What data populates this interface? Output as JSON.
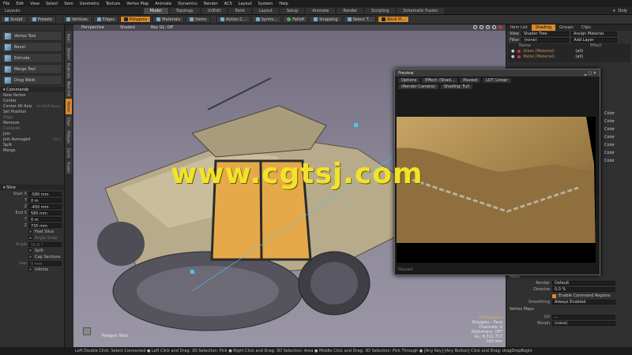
{
  "menu": [
    "File",
    "Edit",
    "View",
    "Select",
    "Item",
    "Geometry",
    "Texture",
    "Vertex Map",
    "Animate",
    "Dynamics",
    "Render",
    "ACS",
    "Layout",
    "System",
    "Help"
  ],
  "layout_label": "Layouts",
  "mode_tabs": [
    {
      "label": "Model",
      "active": true
    },
    {
      "label": "Topology",
      "active": false
    },
    {
      "label": "UVEdit",
      "active": false
    },
    {
      "label": "Paint",
      "active": false
    },
    {
      "label": "Layout",
      "active": false
    },
    {
      "label": "Setup",
      "active": false
    },
    {
      "label": "Animate",
      "active": false
    },
    {
      "label": "Render",
      "active": false
    },
    {
      "label": "Scripting",
      "active": false
    },
    {
      "label": "Schematic Fusion",
      "active": false
    }
  ],
  "only_label": "Only",
  "toolbar": {
    "sculpt": "Sculpt",
    "presets": "Presets",
    "vertices": "Vertices",
    "edges": "Edges",
    "polygons": "Polygons",
    "materials": "Materials",
    "items": "Items",
    "action_center": "Action C...",
    "symmetry": "Symm...",
    "falloff": "Falloff",
    "snapping": "Snapping",
    "select_through": "Select T...",
    "work_plane": "Work Pl..."
  },
  "tools": [
    "Vertex Tool",
    "Bevel",
    "Extrude",
    "Merge Tool",
    "Drag Weld"
  ],
  "commands": {
    "header": "Commands",
    "items": [
      {
        "label": "New Vertex",
        "key": "",
        "dim": false
      },
      {
        "label": "Center",
        "key": "",
        "dim": false
      },
      {
        "label": "Center All Axis",
        "key": "Ctrl-Shift-Space",
        "dim": false
      },
      {
        "label": "Set Position",
        "key": "",
        "dim": false
      },
      {
        "label": "Align",
        "key": "",
        "dim": true
      },
      {
        "label": "Remove",
        "key": "",
        "dim": false
      },
      {
        "label": "Collapse",
        "key": "",
        "dim": true
      },
      {
        "label": "Join",
        "key": "",
        "dim": false
      },
      {
        "label": "Join Averaged",
        "key": "Ctrl-J",
        "dim": false
      },
      {
        "label": "Split",
        "key": "",
        "dim": false
      },
      {
        "label": "Merge",
        "key": "",
        "dim": false
      }
    ]
  },
  "side_tabs": [
    "Basic",
    "Deform",
    "Duplicate",
    "Mesh Edit",
    "Vertex",
    "Edge",
    "Polygon",
    "Curve",
    "Fusion"
  ],
  "slice": {
    "header": "Slice",
    "start_label": "Start X",
    "end_label": "End X",
    "y_label": "Y",
    "z_label": "Z",
    "start": [
      "-580 mm",
      "0 m",
      "-450 mm"
    ],
    "end": [
      "585 mm",
      "0 m",
      "735 mm"
    ],
    "options": [
      {
        "label": "Feet Slice",
        "dim": false
      },
      {
        "label": "Angle Snap",
        "dim": true
      },
      {
        "label": "Split",
        "dim": false
      },
      {
        "label": "Cap Sections",
        "dim": false
      },
      {
        "label": "Infinite",
        "dim": false
      }
    ],
    "angle_label": "Angle",
    "angle_value": "15.0 °",
    "gap_label": "Gap",
    "gap_value": "0 mm"
  },
  "viewport": {
    "tabs": [
      "Perspective",
      "Shaded",
      "Ray GL: Off"
    ],
    "selection_label": "Polygon Slice",
    "info_polys": "44 Polygons",
    "info_lines": [
      "Polygons : Face",
      "Channels: 0",
      "Deformers: OFF",
      "GL: 8,311,717",
      "100 mm"
    ]
  },
  "preview": {
    "title": "Preview",
    "bar1": [
      "Options",
      "Effect: (Shad...",
      "Paused",
      "LUT: Linear"
    ],
    "bar2": [
      "(Render Camera)",
      "Shading: Full"
    ],
    "status": "Paused"
  },
  "watermark": "www.cgtsj.com",
  "right": {
    "tabs": [
      "Item List",
      "Shading",
      "Groups",
      "Clips"
    ],
    "view_label": "View",
    "view_value": "Shader Tree",
    "assign": "Assign Material",
    "filter_label": "Filter",
    "filter_value": "(none)",
    "add_layer": "Add Layer",
    "col_name": "Name",
    "col_effect": "Effect",
    "materials": [
      {
        "name": "Glass (Material)",
        "effect": "(all)",
        "color": "#c23b3b"
      },
      {
        "name": "Metal (Material)",
        "effect": "(all)",
        "color": "#c23b3b"
      }
    ],
    "color_labels": [
      "Color",
      "Color",
      "Color",
      "Color",
      "Color",
      "Color",
      "Color"
    ],
    "mesh_label": "Mesh",
    "render_label": "Render",
    "render_value": "Default",
    "dissolve_label": "Dissolve",
    "dissolve_value": "0.0 %",
    "enable_cmd": "Enable Command Regions",
    "smoothing_label": "Smoothing",
    "smoothing_value": "Always Enabled",
    "vmaps_label": "Vertex Maps",
    "uv_label": "UV",
    "uv_value": "...",
    "morph_label": "Morph",
    "morph_value": "(none)"
  },
  "statusbar": "Left Double Click: Select Connected ● Left Click and Drag: 3D Selection: Pick ● Right Click and Drag: 3D Selection: Area ● Middle Click and Drag: 3D Selection: Pick Through ● [Any Key]-[Any Button] Click and Drag: dragDropBegin",
  "colors": {
    "accent": "#d9892c",
    "viewport_bg": "#8a8597",
    "watermark": "#f2e22c"
  }
}
